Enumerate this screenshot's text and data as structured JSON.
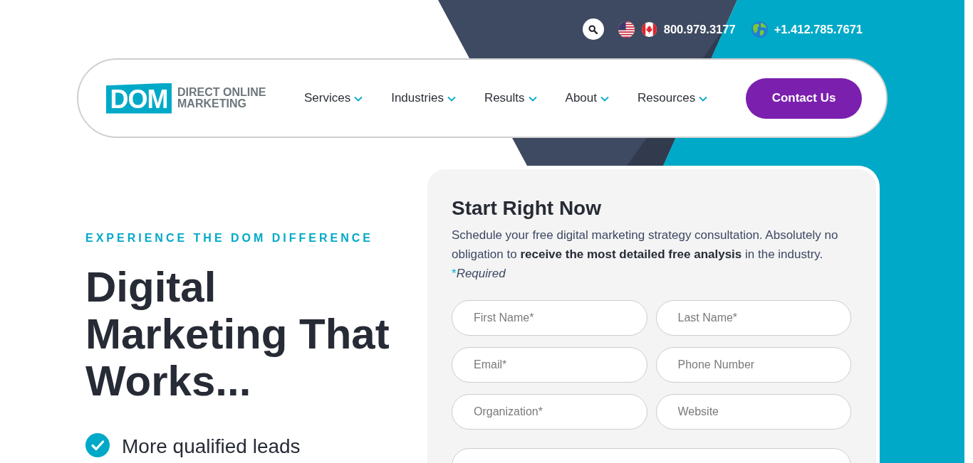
{
  "top_bar": {
    "phones": [
      {
        "kind": "domestic",
        "number": "800.979.3177"
      },
      {
        "kind": "international",
        "number": "+1.412.785.7671"
      }
    ]
  },
  "header": {
    "logo": {
      "mark": "DOM",
      "text": "DIRECT ONLINE MARKETING"
    },
    "nav": [
      {
        "label": "Services",
        "dropdown": true
      },
      {
        "label": "Industries",
        "dropdown": true
      },
      {
        "label": "Results",
        "dropdown": true
      },
      {
        "label": "About",
        "dropdown": true
      },
      {
        "label": "Resources",
        "dropdown": true
      }
    ],
    "cta": "Contact Us"
  },
  "hero": {
    "eyebrow": "EXPERIENCE THE DOM DIFFERENCE",
    "title": "Digital Marketing That Works...",
    "benefits": [
      "More qualified leads"
    ]
  },
  "form": {
    "title": "Start Right Now",
    "intro": "Schedule your free digital marketing strategy consultation. Absolutely no obligation to **receive the most detailed free analysis** in the industry.",
    "required_note": {
      "mark": "*",
      "label": "Required"
    },
    "fields": [
      {
        "kind": "half",
        "placeholder": "First Name*"
      },
      {
        "kind": "half",
        "placeholder": "Last Name*"
      },
      {
        "kind": "half",
        "placeholder": "Email*"
      },
      {
        "kind": "half",
        "placeholder": "Phone Number"
      },
      {
        "kind": "half",
        "placeholder": "Organization*"
      },
      {
        "kind": "half",
        "placeholder": "Website"
      },
      {
        "kind": "wide"
      }
    ]
  }
}
